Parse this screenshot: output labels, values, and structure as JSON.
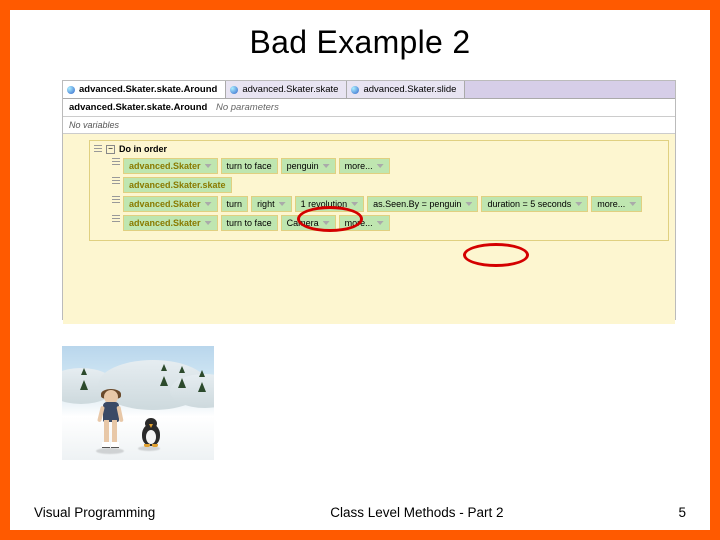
{
  "slide": {
    "title": "Bad Example 2",
    "footer_left": "Visual Programming",
    "footer_center": "Class Level Methods - Part 2",
    "footer_right": "5"
  },
  "editor": {
    "tabs": [
      {
        "label": "advanced.Skater.skate.Around"
      },
      {
        "label": "advanced.Skater.skate"
      },
      {
        "label": "advanced.Skater.slide"
      }
    ],
    "signature": {
      "name": "advanced.Skater.skate.Around",
      "params": "No parameters"
    },
    "no_variables": "No variables",
    "do_in_order": "Do in order",
    "rows": [
      {
        "segments": [
          {
            "text": "advanced.Skater",
            "kind": "obj"
          },
          {
            "text": "turn to face"
          },
          {
            "text": "penguin"
          },
          {
            "text": "more..."
          }
        ]
      },
      {
        "segments": [
          {
            "text": "advanced.Skater.skate",
            "kind": "obj"
          }
        ]
      },
      {
        "segments": [
          {
            "text": "advanced.Skater",
            "kind": "obj"
          },
          {
            "text": "turn"
          },
          {
            "text": "right"
          },
          {
            "text": "1 revolution"
          },
          {
            "text": "as.Seen.By = penguin"
          },
          {
            "text": "duration = 5 seconds"
          },
          {
            "text": "more..."
          }
        ]
      },
      {
        "segments": [
          {
            "text": "advanced.Skater",
            "kind": "obj"
          },
          {
            "text": "turn to face"
          },
          {
            "text": "Camera"
          },
          {
            "text": "more..."
          }
        ]
      }
    ]
  }
}
